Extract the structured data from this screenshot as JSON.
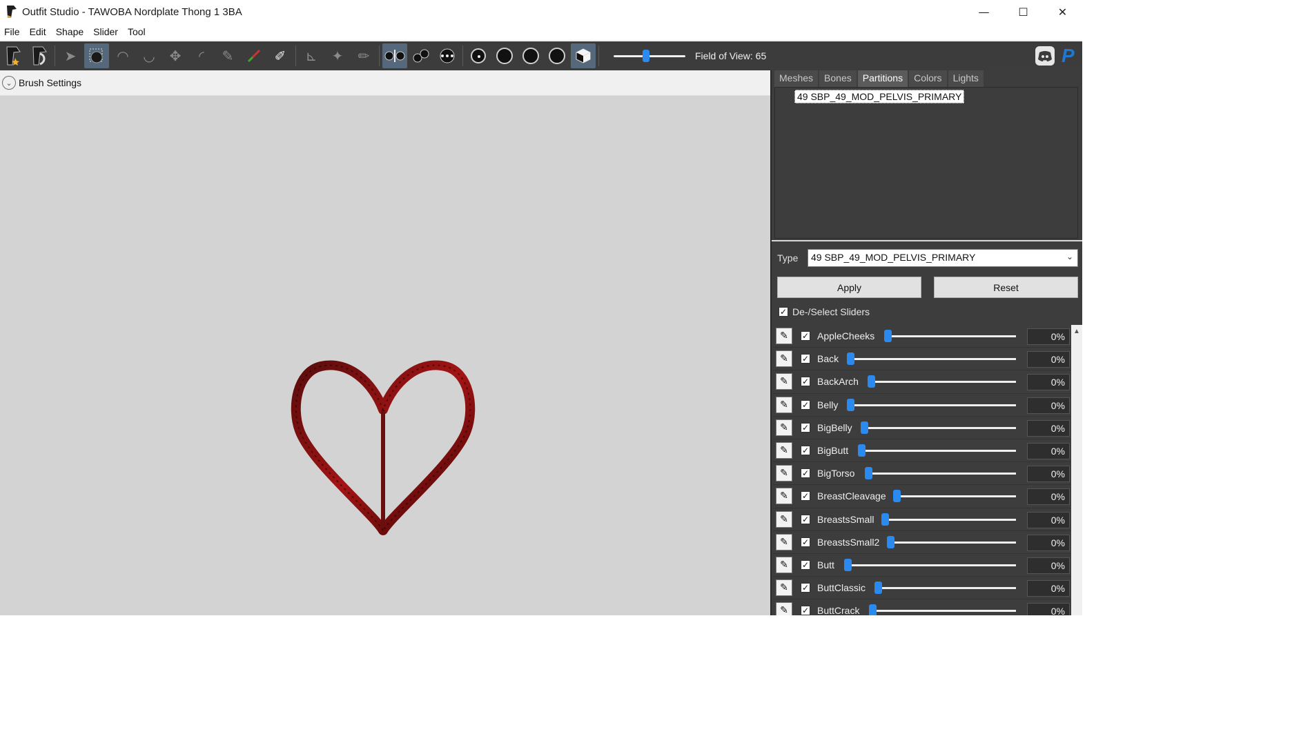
{
  "window": {
    "title": "Outfit Studio - TAWOBA Nordplate Thong 1 3BA",
    "controls": {
      "minimize": "—",
      "maximize": "☐",
      "close": "✕"
    }
  },
  "menu": [
    "File",
    "Edit",
    "Shape",
    "Slider",
    "Tool"
  ],
  "toolbar": {
    "fov_label": "Field of View: 65",
    "fov_fraction": 0.45,
    "icons": [
      "outfit-studio-icon",
      "bodyslide-icon",
      "select-icon",
      "mask-icon",
      "inflate-icon",
      "deflate-icon",
      "move-icon",
      "smooth-icon",
      "mask-brush-icon",
      "color-icon",
      "alpha-icon",
      "transform-icon",
      "pivot-icon",
      "vertex-edit-icon",
      "mirror-icon",
      "connected-icon",
      "points-icon",
      "shading-1-icon",
      "shading-2-icon",
      "shading-3-icon",
      "shading-4-icon",
      "texture-cube-icon",
      "discord-icon",
      "paypal-icon"
    ]
  },
  "brush": {
    "label": "Brush Settings"
  },
  "panel": {
    "tabs": [
      "Meshes",
      "Bones",
      "Partitions",
      "Colors",
      "Lights"
    ],
    "selected_tab": "Partitions",
    "partition_item": "49 SBP_49_MOD_PELVIS_PRIMARY",
    "type_label": "Type",
    "type_value": "49 SBP_49_MOD_PELVIS_PRIMARY",
    "apply_label": "Apply",
    "reset_label": "Reset",
    "deselect_label": "De-/Select Sliders"
  },
  "sliders": [
    {
      "name": "AppleCheeks",
      "value": "0%"
    },
    {
      "name": "Back",
      "value": "0%"
    },
    {
      "name": "BackArch",
      "value": "0%"
    },
    {
      "name": "Belly",
      "value": "0%"
    },
    {
      "name": "BigBelly",
      "value": "0%"
    },
    {
      "name": "BigButt",
      "value": "0%"
    },
    {
      "name": "BigTorso",
      "value": "0%"
    },
    {
      "name": "BreastCleavage",
      "value": "0%"
    },
    {
      "name": "BreastsSmall",
      "value": "0%"
    },
    {
      "name": "BreastsSmall2",
      "value": "0%"
    },
    {
      "name": "Butt",
      "value": "0%"
    },
    {
      "name": "ButtClassic",
      "value": "0%"
    },
    {
      "name": "ButtCrack",
      "value": "0%"
    }
  ],
  "colors": {
    "accent": "#2a8af0",
    "panel_bg": "#3d3d3d",
    "viewport_bg": "#d3d3d3"
  }
}
